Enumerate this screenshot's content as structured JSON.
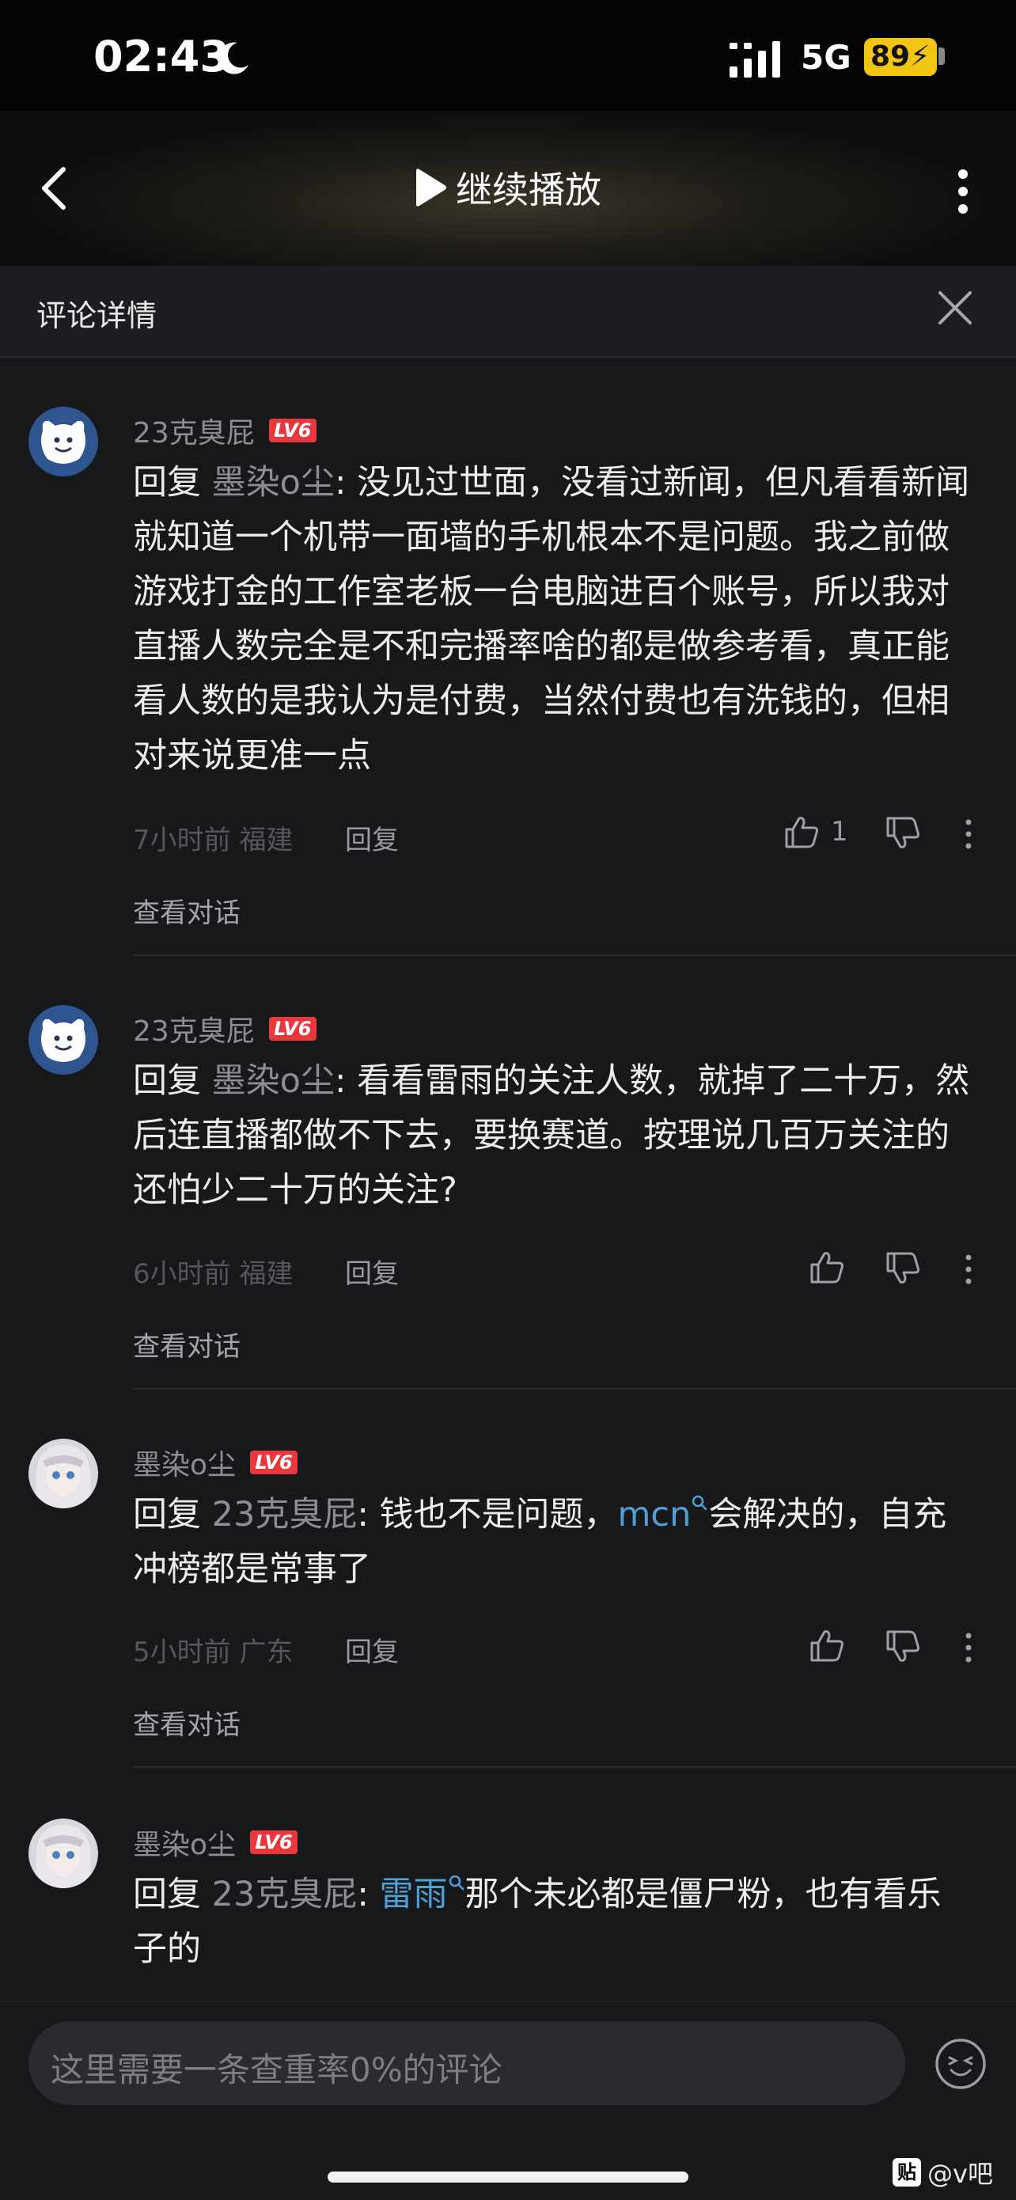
{
  "status_bar": {
    "time": "02:43",
    "network": "5G",
    "battery": "89"
  },
  "top_bar": {
    "continue_play": "继续播放"
  },
  "detail_header": {
    "title": "评论详情"
  },
  "comments": [
    {
      "username": "23克臭屁",
      "level": "LV6",
      "reply_label": "回复 ",
      "reply_to": "墨染o尘",
      "text": ": 没见过世面，没看过新闻，但凡看看新闻就知道一个机带一面墙的手机根本不是问题。我之前做游戏打金的工作室老板一台电脑进百个账号，所以我对直播人数完全是不和完播率啥的都是做参考看，真正能看人数的是我认为是付费，当然付费也有洗钱的，但相对来说更准一点",
      "time_location": "7小时前 福建",
      "reply_btn": "回复",
      "like_count": "1",
      "view_conversation": "查看对话"
    },
    {
      "username": "23克臭屁",
      "level": "LV6",
      "reply_label": "回复 ",
      "reply_to": "墨染o尘",
      "text": ": 看看雷雨的关注人数，就掉了二十万，然后连直播都做不下去，要换赛道。按理说几百万关注的还怕少二十万的关注?",
      "time_location": "6小时前 福建",
      "reply_btn": "回复",
      "view_conversation": "查看对话"
    },
    {
      "username": "墨染o尘",
      "level": "LV6",
      "reply_label": "回复 ",
      "reply_to": "23克臭屁",
      "text_before": ": 钱也不是问题，",
      "link": "mcn",
      "text_after": "会解决的，自充冲榜都是常事了",
      "time_location": "5小时前 广东",
      "reply_btn": "回复",
      "view_conversation": "查看对话"
    },
    {
      "username": "墨染o尘",
      "level": "LV6",
      "reply_label": "回复 ",
      "reply_to": "23克臭屁",
      "text_before": ": ",
      "link": "雷雨",
      "text_after": "那个未必都是僵尸粉，也有看乐子的"
    }
  ],
  "input": {
    "placeholder": "这里需要一条查重率0%的评论"
  },
  "watermark": {
    "icon": "贴",
    "text": "@v吧"
  },
  "colors": {
    "background": "#17181a",
    "link": "#4fa0d6",
    "level_badge": "#e8383d",
    "battery": "#f2c515"
  }
}
